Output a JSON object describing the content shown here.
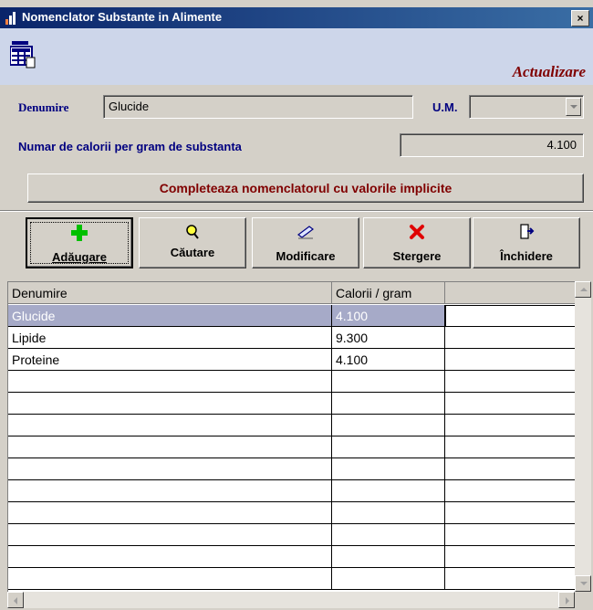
{
  "window": {
    "title": "Nomenclator Substante in Alimente",
    "close_label": "×",
    "mode_label": "Actualizare"
  },
  "form": {
    "name_label": "Denumire",
    "name_value": "Glucide",
    "um_label": "U.M.",
    "um_value": "",
    "calories_label": "Numar de calorii per gram de substanta",
    "calories_value": "4.100",
    "defaults_button_label": "Completeaza nomenclatorul cu valorile implicite"
  },
  "toolbar": {
    "buttons": [
      {
        "label": "Adăugare",
        "icon": "plus-icon",
        "color": "#00c000"
      },
      {
        "label": "Căutare",
        "icon": "magnifier-icon",
        "color": "#c0a000"
      },
      {
        "label": "Modificare",
        "icon": "edit-icon",
        "color": "#000080"
      },
      {
        "label": "Stergere",
        "icon": "delete-icon",
        "color": "#e00000"
      },
      {
        "label": "Închidere",
        "icon": "exit-door-icon",
        "color": "#000080"
      }
    ]
  },
  "grid": {
    "columns": [
      "Denumire",
      "Calorii / gram",
      ""
    ],
    "rows": [
      {
        "name": "Glucide",
        "calories": "4.100",
        "selected": true
      },
      {
        "name": "Lipide",
        "calories": "9.300",
        "selected": false
      },
      {
        "name": "Proteine",
        "calories": "4.100",
        "selected": false
      }
    ]
  },
  "colors": {
    "title_gradient_start": "#0a246a",
    "header_band": "#cdd6ea",
    "label_blue": "#000080",
    "accent_maroon": "#800000",
    "selection": "#a6aac8"
  }
}
